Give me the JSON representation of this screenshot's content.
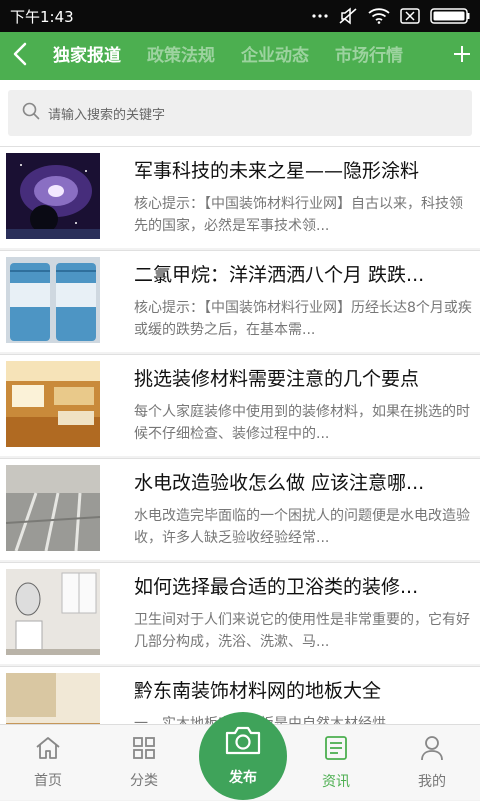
{
  "status_bar": {
    "time": "下午1:43",
    "icons": [
      "more-dots-icon",
      "mute-icon",
      "wifi-icon",
      "sim-x-icon",
      "battery-icon"
    ]
  },
  "nav": {
    "tabs": [
      {
        "label": "独家报道",
        "active": true
      },
      {
        "label": "政策法规",
        "active": false
      },
      {
        "label": "企业动态",
        "active": false
      },
      {
        "label": "市场行情",
        "active": false
      }
    ]
  },
  "search": {
    "placeholder": "请输入搜索的关键字"
  },
  "news": [
    {
      "title": "军事科技的未来之星——隐形涂料",
      "summary": "核心提示：【中国装饰材料行业网】自古以来，科技领先的国家，必然是军事技术领...",
      "thumb": "galaxy"
    },
    {
      "title": "二氯甲烷：洋洋洒洒八个月 跌跌...",
      "summary": "核心提示：【中国装饰材料行业网】历经长达8个月或疾或缓的跌势之后，在基本需...",
      "thumb": "barrels"
    },
    {
      "title": "挑选装修材料需要注意的几个要点",
      "summary": "每个人家庭装修中使用到的装修材料，如果在挑选的时候不仔细检查、装修过程中的...",
      "thumb": "living-room"
    },
    {
      "title": "水电改造验收怎么做 应该注意哪...",
      "summary": "水电改造完毕面临的一个困扰人的问题便是水电改造验收，许多人缺乏验收经验经常...",
      "thumb": "floor-pipes"
    },
    {
      "title": "如何选择最合适的卫浴类的装修...",
      "summary": "卫生间对于人们来说它的使用性是非常重要的，它有好几部分构成，洗浴、洗漱、马...",
      "thumb": "bathroom"
    },
    {
      "title": "黔东南装饰材料网的地板大全",
      "summary": "一、实木地板实木地板是由自然木材经烘",
      "thumb": "wood-floor"
    }
  ],
  "bottom_nav": {
    "items": [
      {
        "label": "首页",
        "icon": "home-icon"
      },
      {
        "label": "分类",
        "icon": "grid-icon"
      },
      {
        "label": "资讯",
        "icon": "news-icon"
      },
      {
        "label": "我的",
        "icon": "user-icon"
      }
    ],
    "publish_label": "发布",
    "active_color": "#4caf50"
  },
  "colors": {
    "accent": "#4caf50",
    "publish": "#3fa35a",
    "status_bar": "#0b0b0b"
  }
}
